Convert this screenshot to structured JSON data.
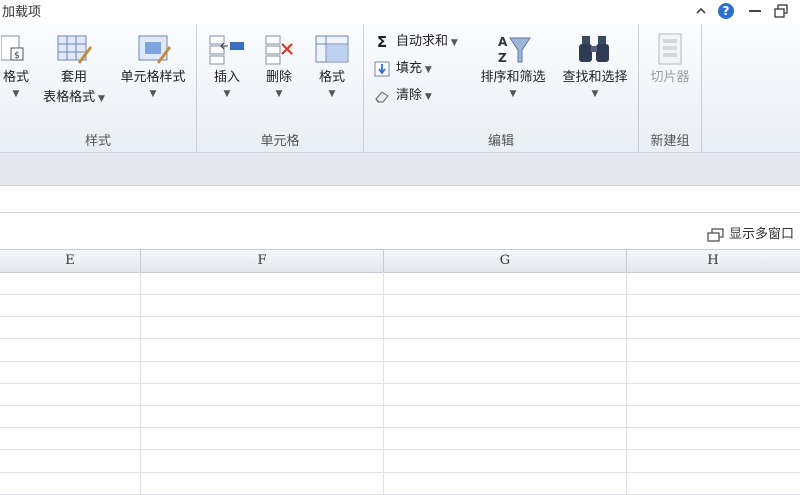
{
  "tabs": {
    "addins": "加载项"
  },
  "ribbon": {
    "styles": {
      "cond_format_partial": "格式",
      "table_format_line1": "套用",
      "table_format_line2": "表格格式",
      "cell_styles": "单元格样式",
      "group_label": "样式"
    },
    "cells": {
      "insert": "插入",
      "delete": "删除",
      "format": "格式",
      "group_label": "单元格"
    },
    "editing": {
      "autosum": "自动求和",
      "fill": "填充",
      "clear": "清除",
      "sort_filter": "排序和筛选",
      "find_select": "查找和选择",
      "group_label": "编辑"
    },
    "newgroup": {
      "slicer": "切片器",
      "group_label": "新建组"
    }
  },
  "view": {
    "show_multi_window": "显示多窗口"
  },
  "columns": [
    "E",
    "F",
    "G",
    "H"
  ],
  "colors": {
    "accent_blue": "#3b6fc2",
    "help_blue": "#2f6fd0",
    "red_x": "#d83a2a"
  }
}
